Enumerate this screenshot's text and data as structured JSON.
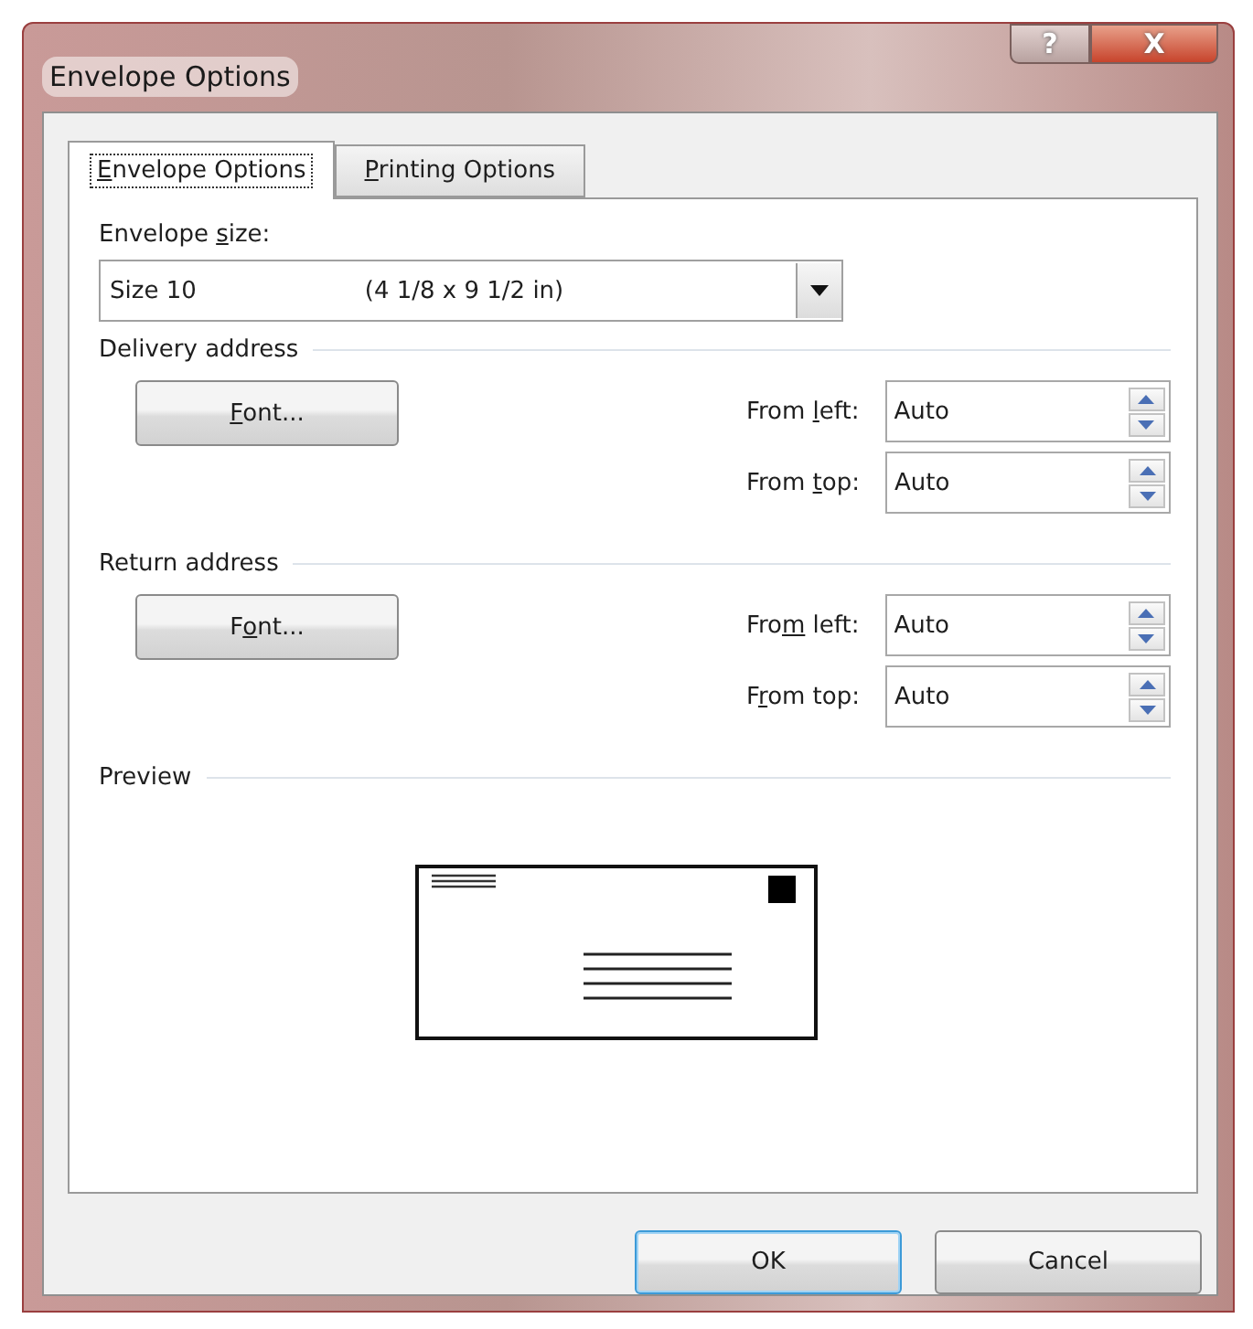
{
  "window": {
    "title": "Envelope Options",
    "help_button": "?",
    "close_button": "X"
  },
  "tabs": [
    {
      "label": {
        "key": "E",
        "post": "nvelope Options"
      },
      "selected": true
    },
    {
      "label": {
        "key": "P",
        "post": "rinting Options"
      },
      "selected": false
    }
  ],
  "envelope_size": {
    "label": {
      "pre": "Envelope ",
      "key": "s",
      "post": "ize:"
    },
    "size": "Size 10",
    "dimensions": "(4 1/8 x 9 1/2 in)"
  },
  "sections": [
    {
      "title": "Delivery address",
      "font_button": {
        "key": "F",
        "post": "ont..."
      },
      "fields": [
        {
          "label": {
            "pre": "From ",
            "key": "l",
            "post": "eft:"
          },
          "value": "Auto"
        },
        {
          "label": {
            "pre": "From ",
            "key": "t",
            "post": "op:"
          },
          "value": "Auto"
        }
      ]
    },
    {
      "title": "Return address",
      "font_button": {
        "pre": "F",
        "key": "o",
        "post": "nt..."
      },
      "fields": [
        {
          "label": {
            "pre": "Fro",
            "key": "m",
            "post": " left:"
          },
          "value": "Auto"
        },
        {
          "label": {
            "pre": "F",
            "key": "r",
            "post": "om top:"
          },
          "value": "Auto"
        }
      ]
    }
  ],
  "preview": {
    "title": "Preview"
  },
  "buttons": [
    {
      "label": "OK",
      "default": true
    },
    {
      "label": "Cancel",
      "default": false
    }
  ]
}
